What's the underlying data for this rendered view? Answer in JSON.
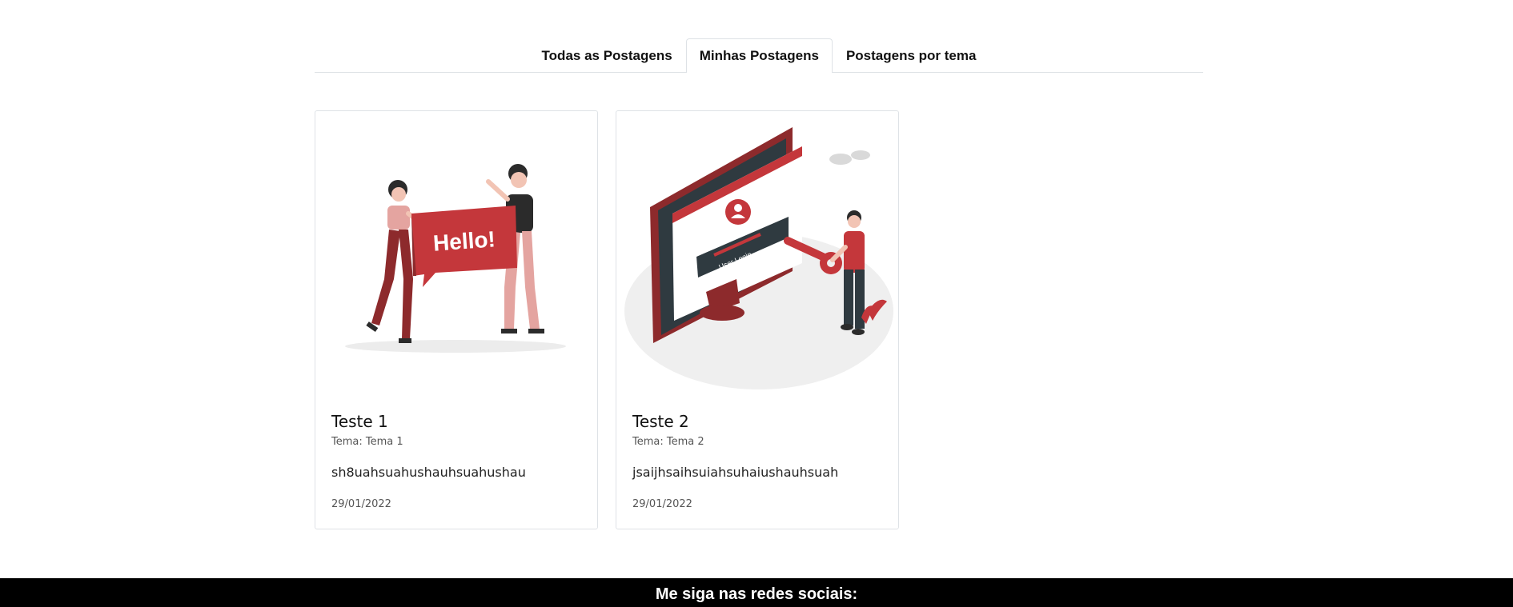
{
  "tabs": [
    {
      "label": "Todas as Postagens",
      "active": false
    },
    {
      "label": "Minhas Postagens",
      "active": true
    },
    {
      "label": "Postagens por tema",
      "active": false
    }
  ],
  "posts": [
    {
      "title": "Teste 1",
      "theme": "Tema: Tema 1",
      "text": "sh8uahsuahushauhsuahushau",
      "date": "29/01/2022",
      "illustration": {
        "icon": "hello-people-illustration",
        "banner_text": "Hello!"
      }
    },
    {
      "title": "Teste 2",
      "theme": "Tema: Tema 2",
      "text": "jsaijhsaihsuiahsuhaiushauhsuah",
      "date": "29/01/2022",
      "illustration": {
        "icon": "user-login-illustration",
        "screen_text": "User Login"
      }
    }
  ],
  "footer": {
    "text": "Me siga nas redes sociais:"
  },
  "colors": {
    "accent": "#c4373b",
    "dark_accent": "#8d2a2c",
    "footer_bg": "#000000",
    "border": "#dee2e6"
  }
}
